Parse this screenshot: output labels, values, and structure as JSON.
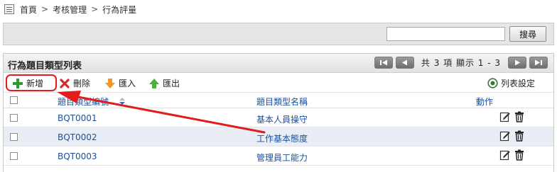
{
  "breadcrumb": {
    "items": [
      "首頁",
      "考核管理",
      "行為評量"
    ],
    "separator": ">"
  },
  "search": {
    "value": "",
    "placeholder": "",
    "button_label": "搜尋"
  },
  "list": {
    "title": "行為題目類型列表",
    "pager_text": "共 3 項 顯示 1 - 3",
    "toolbar": {
      "add": "新增",
      "delete": "刪除",
      "import": "匯入",
      "export": "匯出",
      "settings": "列表設定"
    },
    "columns": [
      "題目類型編號",
      "題目類型名稱",
      "動作"
    ],
    "rows": [
      {
        "code": "BQT0001",
        "name": "基本人員操守"
      },
      {
        "code": "BQT0002",
        "name": "工作基本態度"
      },
      {
        "code": "BQT0003",
        "name": "管理員工能力"
      }
    ]
  },
  "colors": {
    "annotation": "#e41b1b",
    "link": "#1a4f9c",
    "alt_row": "#e9eef6"
  },
  "icons": [
    "breadcrumb-icon",
    "first-page-icon",
    "prev-page-icon",
    "next-page-icon",
    "last-page-icon",
    "plus-icon",
    "x-icon",
    "arrow-down-icon",
    "arrow-up-icon",
    "settings-icon",
    "sort-icon",
    "edit-icon",
    "trash-icon"
  ]
}
